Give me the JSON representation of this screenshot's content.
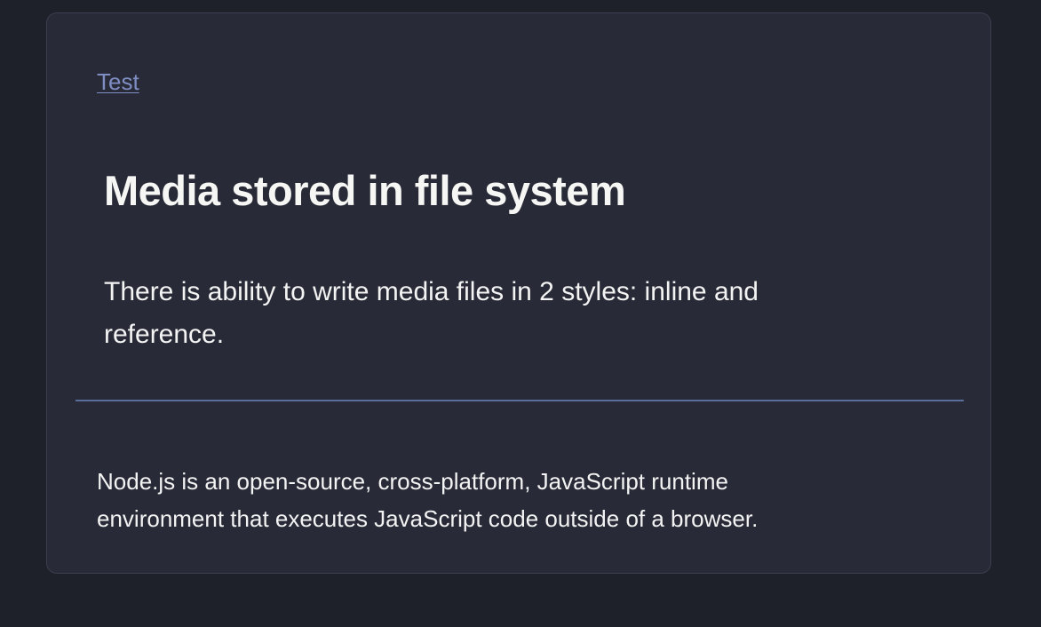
{
  "card": {
    "link_label": "Test",
    "title": "Media stored in file system",
    "description": "There is ability to write media files in 2 styles: inline and reference.",
    "footer_text": "Node.js is an open-source, cross-platform, JavaScript runtime environment that executes JavaScript code outside of a browser."
  },
  "colors": {
    "page_background": "#1f212a",
    "card_background": "#282b37",
    "card_border": "#3b3f4f",
    "link": "#7f8dc3",
    "divider": "#5a6e9c",
    "text": "#f3f3f3"
  }
}
